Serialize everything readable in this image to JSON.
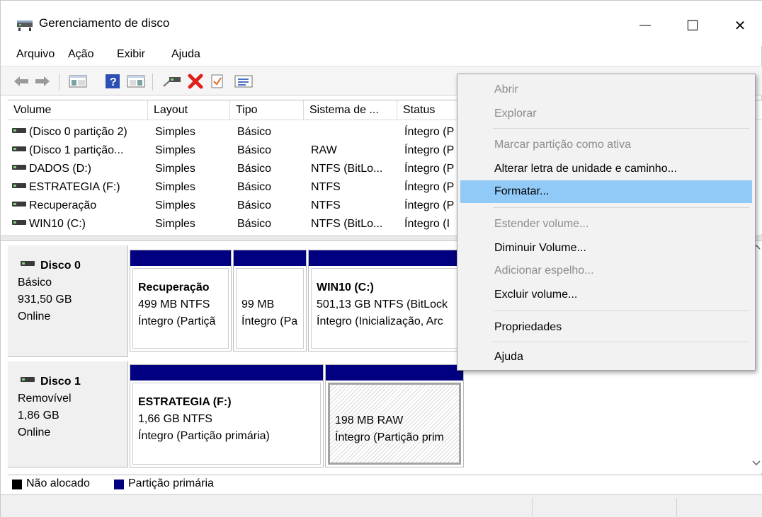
{
  "window": {
    "title": "Gerenciamento de disco",
    "minimize_glyph": "—",
    "maximize_glyph": "☐",
    "close_glyph": "✕"
  },
  "menubar": {
    "items": [
      "Arquivo",
      "Ação",
      "Exibir",
      "Ajuda"
    ]
  },
  "toolbar": {
    "icons": [
      "back-arrow-icon",
      "forward-arrow-icon",
      "console-tree-icon",
      "help-icon",
      "properties-panel-icon",
      "connect-icon",
      "delete-icon",
      "check-icon",
      "list-icon"
    ]
  },
  "volume_list": {
    "columns": [
      "Volume",
      "Layout",
      "Tipo",
      "Sistema de ...",
      "Status"
    ],
    "rows": [
      {
        "volume": "(Disco 0 partição 2)",
        "layout": "Simples",
        "tipo": "Básico",
        "fs": "",
        "status": "Íntegro (P"
      },
      {
        "volume": "(Disco 1 partição...",
        "layout": "Simples",
        "tipo": "Básico",
        "fs": "RAW",
        "status": "Íntegro (P"
      },
      {
        "volume": "DADOS (D:)",
        "layout": "Simples",
        "tipo": "Básico",
        "fs": "NTFS (BitLo...",
        "status": "Íntegro (P"
      },
      {
        "volume": "ESTRATEGIA (F:)",
        "layout": "Simples",
        "tipo": "Básico",
        "fs": "NTFS",
        "status": "Íntegro (P"
      },
      {
        "volume": "Recuperação",
        "layout": "Simples",
        "tipo": "Básico",
        "fs": "NTFS",
        "status": "Íntegro (P"
      },
      {
        "volume": "WIN10 (C:)",
        "layout": "Simples",
        "tipo": "Básico",
        "fs": "NTFS (BitLo...",
        "status": "Íntegro (I"
      }
    ]
  },
  "disks": [
    {
      "name": "Disco 0",
      "type": "Básico",
      "size": "931,50 GB",
      "state": "Online",
      "partitions": [
        {
          "title": "Recuperação",
          "line1": "499 MB NTFS",
          "line2": "Íntegro (Partiçã"
        },
        {
          "title": "",
          "line1": "99 MB",
          "line2": "Íntegro (Pa"
        },
        {
          "title": "WIN10  (C:)",
          "line1": "501,13 GB NTFS (BitLock",
          "line2": "Íntegro (Inicialização, Arc"
        }
      ]
    },
    {
      "name": "Disco 1",
      "type": "Removível",
      "size": "1,86 GB",
      "state": "Online",
      "partitions": [
        {
          "title": "ESTRATEGIA  (F:)",
          "line1": "1,66 GB NTFS",
          "line2": "Íntegro (Partição primária)"
        },
        {
          "title": "",
          "line1": "198 MB RAW",
          "line2": "Íntegro (Partição prim"
        }
      ]
    }
  ],
  "legend": {
    "unallocated": "Não alocado",
    "primary": "Partição primária",
    "unallocated_color": "#000000",
    "primary_color": "#000080"
  },
  "context_menu": {
    "items": [
      {
        "label": "Abrir",
        "enabled": false
      },
      {
        "label": "Explorar",
        "enabled": false
      },
      {
        "label": "Marcar partição como ativa",
        "enabled": false
      },
      {
        "label": "Alterar letra de unidade e caminho...",
        "enabled": true
      },
      {
        "label": "Formatar...",
        "enabled": true,
        "highlighted": true
      },
      {
        "label": "Estender volume...",
        "enabled": false
      },
      {
        "label": "Diminuir Volume...",
        "enabled": true
      },
      {
        "label": "Adicionar espelho...",
        "enabled": false
      },
      {
        "label": "Excluir volume...",
        "enabled": true
      },
      {
        "label": "Propriedades",
        "enabled": true
      },
      {
        "label": "Ajuda",
        "enabled": true
      }
    ],
    "highlight_color": "#91c9f7"
  }
}
